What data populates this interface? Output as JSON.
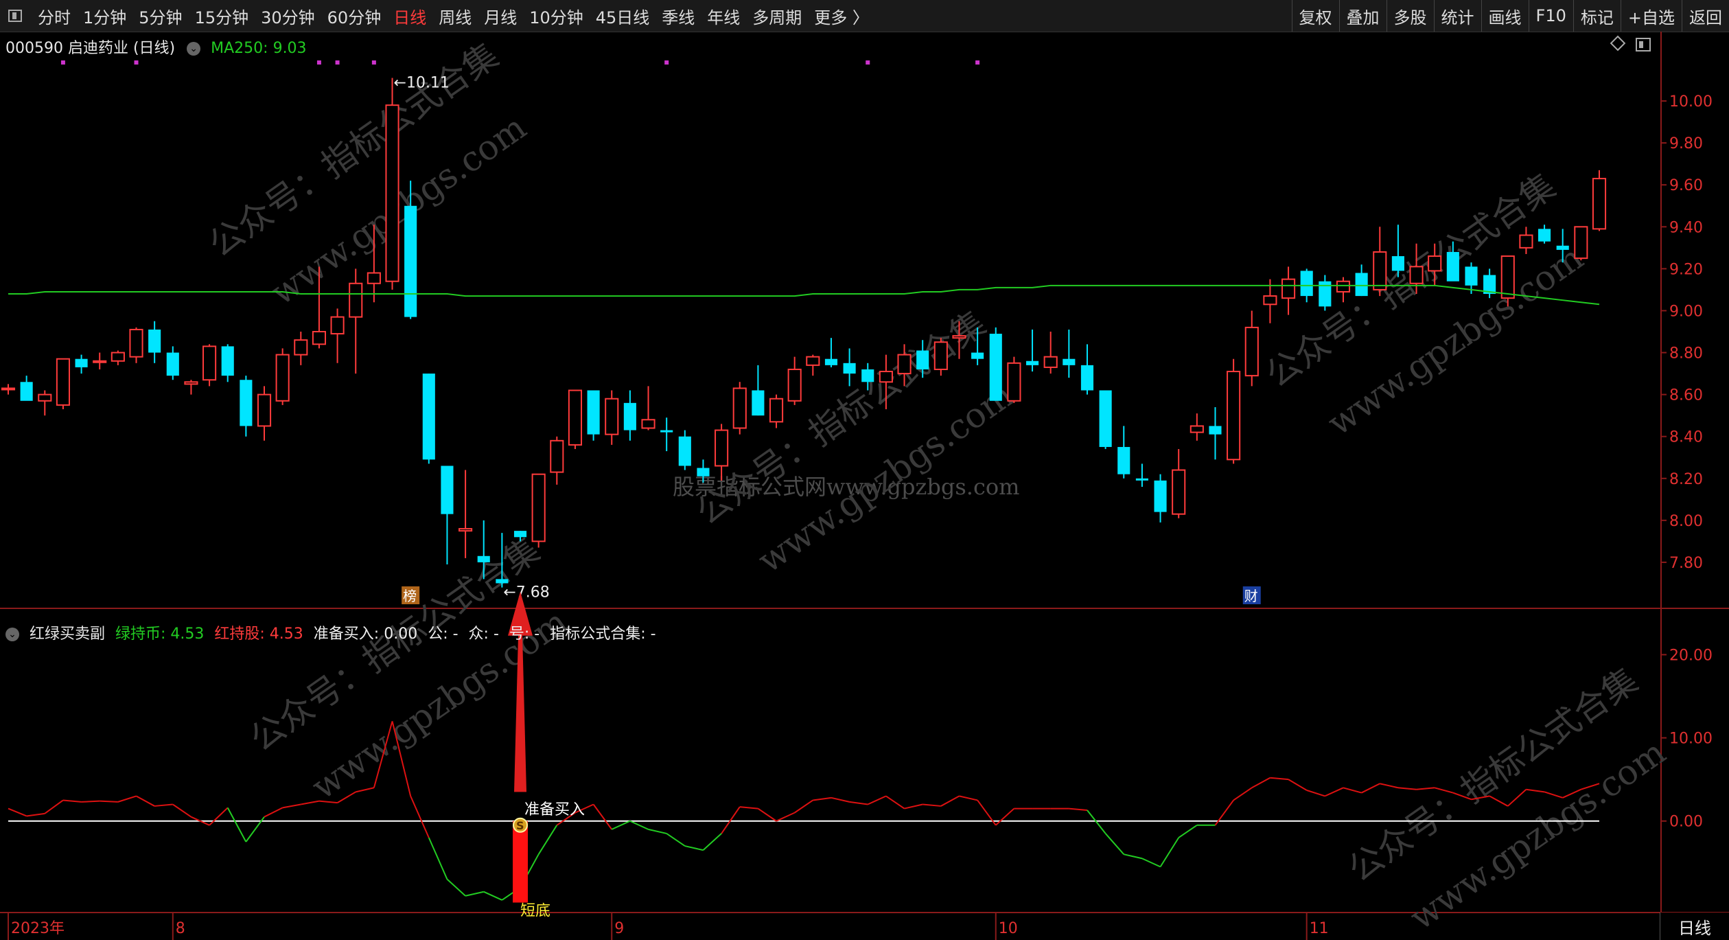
{
  "toolbar": {
    "periods": [
      "分时",
      "1分钟",
      "5分钟",
      "15分钟",
      "30分钟",
      "60分钟",
      "日线",
      "周线",
      "月线",
      "10分钟",
      "45日线",
      "季线",
      "年线",
      "多周期",
      "更多 〉"
    ],
    "active_period": "日线",
    "right_tools": [
      "复权",
      "叠加",
      "多股",
      "统计",
      "画线",
      "F10",
      "标记",
      "+自选",
      "返回"
    ]
  },
  "main_panel": {
    "stock_label": "000590 启迪药业 (日线)",
    "ma_label": "MA250: 9.03",
    "high_marker": "10.11",
    "low_marker": "7.68",
    "tag_bang": "榜",
    "tag_cai": "财",
    "watermark_center": "股票指标公式网www.gpzbgs.com",
    "watermark_diag_1": "公众号：指标公式合集",
    "watermark_diag_2": "www.gpzbgs.com"
  },
  "indicator_panel": {
    "name": "红绿买卖副",
    "green_label": "绿持币: 4.53",
    "red_label": "红持股: 4.53",
    "prepare_label": "准备买入: 0.00",
    "extra_labels": [
      "公: -",
      "众: -",
      "号: -",
      "指标公式合集: -"
    ],
    "buy_text": "准备买入",
    "bottom_text": "短底",
    "coin_symbol": "S"
  },
  "bottom_period": "日线",
  "colors": {
    "up": "#ff3b3b",
    "down": "#00e5ff",
    "ma": "#22cc22",
    "green_line": "#22cc22",
    "red_line": "#dd1111",
    "zero_line": "#ffffff",
    "purple": "#cc33cc",
    "yellow": "#ffee33"
  },
  "chart_data": {
    "type": "candlestick",
    "price_axis": {
      "ylim": [
        7.6,
        10.2
      ],
      "ticks": [
        7.8,
        8.0,
        8.2,
        8.4,
        8.6,
        8.8,
        9.0,
        9.2,
        9.4,
        9.6,
        9.8,
        10.0
      ]
    },
    "indicator_axis": {
      "ylim": [
        -11,
        24
      ],
      "ticks": [
        0.0,
        10.0,
        20.0
      ]
    },
    "x_labels": [
      {
        "i": 0,
        "text": "2023年"
      },
      {
        "i": 9,
        "text": "8"
      },
      {
        "i": 33,
        "text": "9"
      },
      {
        "i": 54,
        "text": "10"
      },
      {
        "i": 71,
        "text": "11"
      }
    ],
    "candles": [
      [
        8.63,
        8.65,
        8.6,
        8.63
      ],
      [
        8.66,
        8.69,
        8.58,
        8.57
      ],
      [
        8.57,
        8.62,
        8.5,
        8.6
      ],
      [
        8.55,
        8.76,
        8.53,
        8.77
      ],
      [
        8.77,
        8.79,
        8.7,
        8.73
      ],
      [
        8.76,
        8.8,
        8.72,
        8.76
      ],
      [
        8.76,
        8.81,
        8.74,
        8.8
      ],
      [
        8.78,
        8.92,
        8.75,
        8.91
      ],
      [
        8.91,
        8.95,
        8.75,
        8.8
      ],
      [
        8.8,
        8.83,
        8.67,
        8.69
      ],
      [
        8.65,
        8.67,
        8.6,
        8.66
      ],
      [
        8.67,
        8.84,
        8.64,
        8.83
      ],
      [
        8.83,
        8.84,
        8.66,
        8.69
      ],
      [
        8.67,
        8.69,
        8.4,
        8.45
      ],
      [
        8.45,
        8.64,
        8.38,
        8.6
      ],
      [
        8.57,
        8.82,
        8.55,
        8.79
      ],
      [
        8.79,
        8.9,
        8.74,
        8.86
      ],
      [
        8.84,
        9.21,
        8.82,
        8.9
      ],
      [
        8.89,
        9.01,
        8.75,
        8.97
      ],
      [
        8.97,
        9.2,
        8.7,
        9.13
      ],
      [
        9.13,
        9.41,
        9.04,
        9.18
      ],
      [
        9.14,
        10.11,
        9.1,
        9.98
      ],
      [
        9.5,
        9.62,
        8.96,
        8.97
      ],
      [
        8.7,
        8.7,
        8.27,
        8.29
      ],
      [
        8.26,
        8.26,
        7.79,
        8.03
      ],
      [
        7.95,
        8.24,
        7.82,
        7.96
      ],
      [
        7.83,
        8.0,
        7.72,
        7.8
      ],
      [
        7.72,
        7.94,
        7.68,
        7.7
      ],
      [
        7.95,
        7.95,
        7.9,
        7.92
      ],
      [
        7.9,
        8.22,
        7.87,
        8.22
      ],
      [
        8.23,
        8.4,
        8.17,
        8.38
      ],
      [
        8.36,
        8.62,
        8.34,
        8.62
      ],
      [
        8.62,
        8.62,
        8.38,
        8.41
      ],
      [
        8.41,
        8.62,
        8.36,
        8.58
      ],
      [
        8.56,
        8.62,
        8.38,
        8.43
      ],
      [
        8.44,
        8.64,
        8.43,
        8.48
      ],
      [
        8.43,
        8.49,
        8.33,
        8.42
      ],
      [
        8.4,
        8.43,
        8.24,
        8.26
      ],
      [
        8.25,
        8.29,
        8.18,
        8.21
      ],
      [
        8.26,
        8.46,
        8.19,
        8.43
      ],
      [
        8.44,
        8.66,
        8.41,
        8.63
      ],
      [
        8.62,
        8.74,
        8.5,
        8.5
      ],
      [
        8.47,
        8.6,
        8.44,
        8.58
      ],
      [
        8.57,
        8.78,
        8.55,
        8.72
      ],
      [
        8.74,
        8.79,
        8.69,
        8.78
      ],
      [
        8.77,
        8.87,
        8.73,
        8.74
      ],
      [
        8.75,
        8.82,
        8.64,
        8.7
      ],
      [
        8.72,
        8.75,
        8.62,
        8.66
      ],
      [
        8.66,
        8.79,
        8.53,
        8.71
      ],
      [
        8.7,
        8.84,
        8.64,
        8.79
      ],
      [
        8.81,
        8.86,
        8.68,
        8.72
      ],
      [
        8.72,
        8.87,
        8.69,
        8.85
      ],
      [
        8.87,
        8.95,
        8.77,
        8.88
      ],
      [
        8.8,
        8.92,
        8.74,
        8.77
      ],
      [
        8.89,
        8.92,
        8.58,
        8.57
      ],
      [
        8.57,
        8.78,
        8.56,
        8.75
      ],
      [
        8.76,
        8.91,
        8.71,
        8.74
      ],
      [
        8.73,
        8.9,
        8.7,
        8.78
      ],
      [
        8.77,
        8.91,
        8.68,
        8.74
      ],
      [
        8.74,
        8.84,
        8.6,
        8.62
      ],
      [
        8.62,
        8.62,
        8.34,
        8.35
      ],
      [
        8.35,
        8.45,
        8.2,
        8.22
      ],
      [
        8.2,
        8.27,
        8.16,
        8.19
      ],
      [
        8.19,
        8.22,
        7.99,
        8.04
      ],
      [
        8.03,
        8.34,
        8.01,
        8.24
      ],
      [
        8.42,
        8.51,
        8.38,
        8.45
      ],
      [
        8.45,
        8.54,
        8.29,
        8.41
      ],
      [
        8.29,
        8.77,
        8.27,
        8.71
      ],
      [
        8.69,
        9.0,
        8.64,
        8.92
      ],
      [
        9.03,
        9.15,
        8.94,
        9.07
      ],
      [
        9.06,
        9.21,
        8.98,
        9.15
      ],
      [
        9.19,
        9.2,
        9.04,
        9.07
      ],
      [
        9.14,
        9.17,
        9.0,
        9.02
      ],
      [
        9.09,
        9.16,
        9.04,
        9.14
      ],
      [
        9.18,
        9.22,
        9.07,
        9.07
      ],
      [
        9.1,
        9.4,
        9.07,
        9.28
      ],
      [
        9.26,
        9.41,
        9.16,
        9.19
      ],
      [
        9.13,
        9.32,
        9.08,
        9.21
      ],
      [
        9.19,
        9.32,
        9.12,
        9.26
      ],
      [
        9.28,
        9.33,
        9.2,
        9.14
      ],
      [
        9.21,
        9.23,
        9.08,
        9.12
      ],
      [
        9.17,
        9.2,
        9.06,
        9.08
      ],
      [
        9.06,
        9.24,
        9.02,
        9.26
      ],
      [
        9.3,
        9.4,
        9.27,
        9.36
      ],
      [
        9.39,
        9.41,
        9.32,
        9.33
      ],
      [
        9.31,
        9.39,
        9.23,
        9.29
      ],
      [
        9.25,
        9.4,
        9.24,
        9.4
      ],
      [
        9.39,
        9.67,
        9.38,
        9.63
      ]
    ],
    "ma250": [
      9.08,
      9.08,
      9.09,
      9.09,
      9.09,
      9.09,
      9.09,
      9.09,
      9.09,
      9.09,
      9.09,
      9.09,
      9.09,
      9.09,
      9.09,
      9.09,
      9.08,
      9.08,
      9.08,
      9.08,
      9.08,
      9.08,
      9.08,
      9.08,
      9.08,
      9.07,
      9.07,
      9.07,
      9.07,
      9.07,
      9.07,
      9.07,
      9.07,
      9.07,
      9.07,
      9.07,
      9.07,
      9.07,
      9.07,
      9.07,
      9.07,
      9.07,
      9.07,
      9.07,
      9.08,
      9.08,
      9.08,
      9.08,
      9.08,
      9.08,
      9.09,
      9.09,
      9.1,
      9.1,
      9.11,
      9.11,
      9.11,
      9.12,
      9.12,
      9.12,
      9.12,
      9.12,
      9.12,
      9.12,
      9.12,
      9.12,
      9.12,
      9.12,
      9.12,
      9.12,
      9.12,
      9.12,
      9.12,
      9.12,
      9.12,
      9.12,
      9.12,
      9.12,
      9.12,
      9.11,
      9.1,
      9.09,
      9.08,
      9.07,
      9.06,
      9.05,
      9.04,
      9.03
    ],
    "indicator": [
      1.5,
      0.6,
      0.9,
      2.5,
      2.3,
      2.4,
      2.3,
      3.0,
      1.8,
      2.0,
      0.5,
      -0.5,
      1.6,
      -2.5,
      0.5,
      1.6,
      2.0,
      2.4,
      2.2,
      3.5,
      4.0,
      12.0,
      3.0,
      -2.0,
      -7.0,
      -9.0,
      -8.5,
      -9.5,
      -8.0,
      -4.0,
      -0.5,
      1.0,
      2.0,
      -1.0,
      0.0,
      -1.0,
      -1.5,
      -3.0,
      -3.5,
      -1.5,
      1.7,
      1.5,
      0.0,
      1.0,
      2.5,
      2.8,
      2.3,
      2.0,
      3.0,
      1.5,
      2.0,
      1.8,
      3.0,
      2.5,
      -0.5,
      1.5,
      1.5,
      1.5,
      1.5,
      1.3,
      -1.5,
      -4.0,
      -4.5,
      -5.5,
      -2.0,
      -0.5,
      -0.5,
      2.5,
      4.0,
      5.2,
      5.0,
      3.7,
      3.0,
      4.0,
      3.4,
      4.5,
      4.0,
      3.8,
      4.0,
      3.4,
      2.6,
      3.0,
      1.8,
      3.8,
      3.5,
      2.8,
      3.8,
      4.5
    ]
  }
}
